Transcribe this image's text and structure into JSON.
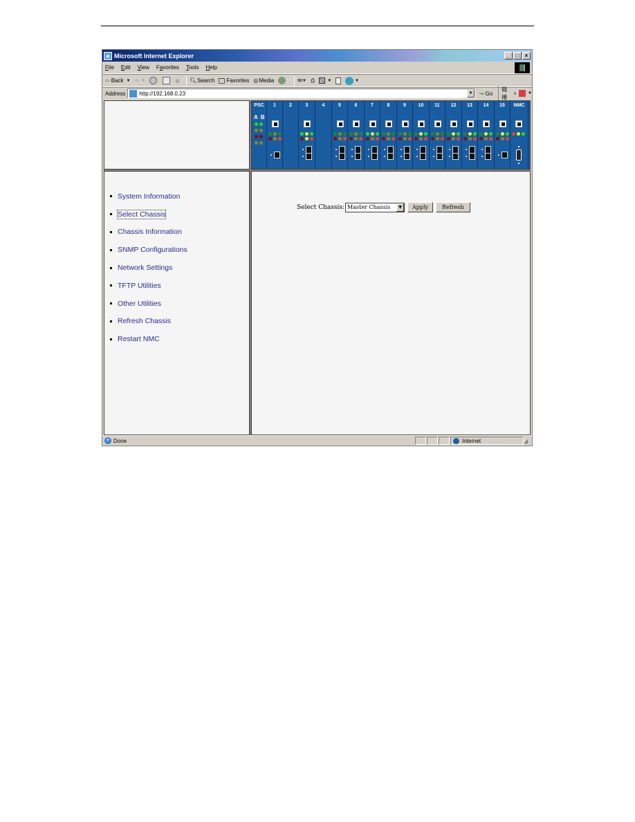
{
  "window": {
    "title": "Microsoft Internet Explorer",
    "menu": [
      {
        "key": "F",
        "label": "File"
      },
      {
        "key": "E",
        "label": "Edit"
      },
      {
        "key": "V",
        "label": "View"
      },
      {
        "key": "a",
        "label": "Favorites"
      },
      {
        "key": "T",
        "label": "Tools"
      },
      {
        "key": "H",
        "label": "Help"
      }
    ],
    "toolbar": {
      "back": "Back",
      "search": "Search",
      "favorites": "Favorites",
      "media": "Media"
    },
    "address": {
      "label": "Address",
      "url": "http://192.168.0.23",
      "go": "Go",
      "links": "链接"
    },
    "status": {
      "text": "Done",
      "zone": "Internet"
    }
  },
  "chassis": {
    "slots": [
      "PSC",
      "1",
      "2",
      "3",
      "4",
      "5",
      "6",
      "7",
      "8",
      "9",
      "10",
      "11",
      "12",
      "13",
      "14",
      "15",
      "NMC"
    ],
    "psc_ab": "A B"
  },
  "nav": {
    "items": [
      "System Information",
      "Select Chassis",
      "Chassis Information",
      "SNMP Configurations",
      "Network Settings",
      "TFTP Utilities",
      "Other Utilities",
      "Refresh Chassis",
      "Restart NMC"
    ],
    "focused": "Select Chassis"
  },
  "main": {
    "select_label": "Select Chassis:",
    "select_value": "Master Chassis",
    "apply": "Apply",
    "refresh": "Refresh"
  }
}
